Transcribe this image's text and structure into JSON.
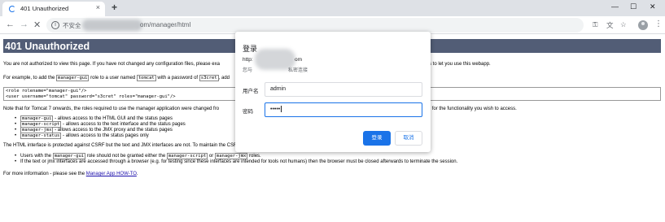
{
  "browser": {
    "tab": {
      "title": "401 Unauthorized",
      "close": "×"
    },
    "new_tab": "+",
    "window": {
      "minimize": "—",
      "maximize": "☐",
      "close": "✕"
    },
    "nav": {
      "back": "←",
      "forward": "→",
      "stop": "✕"
    },
    "address": {
      "security_label": "不安全",
      "path": "om/manager/html",
      "info": "i"
    },
    "toolbar_icons": {
      "key": "⚿",
      "translate": "文",
      "star": "☆",
      "menu": "⋮"
    }
  },
  "page": {
    "title": "401 Unauthorized",
    "intro_a": "You are not authorized to view this page. If you have not changed any configuration files, please exa",
    "intro_b": "e credentials to let you use this webapp.",
    "example_a": "For example, to add the",
    "example_role": "manager-gui",
    "example_b": "role to a user named",
    "example_user": "tomcat",
    "example_c": "with a password of",
    "example_pw": "s3cret",
    "example_d": ", add",
    "config_line1": "<role rolename=\"manager-gui\"/>",
    "config_line2": "<user username=\"tomcat\" password=\"s3cret\" roles=\"manager-gui\"/>",
    "tomcat7_a": "Note that for Tomcat 7 onwards, the roles required to use the manager application were changed fro",
    "tomcat7_b": "e(s) required for the functionality you wish to access.",
    "roles": [
      {
        "code": "manager-gui",
        "text": " - allows access to the HTML GUI and the status pages"
      },
      {
        "code": "manager-script",
        "text": " - allows access to the text interface and the status pages"
      },
      {
        "code": "manager-jmx",
        "text": " - allows access to the JMX proxy and the status pages"
      },
      {
        "code": "manager-status",
        "text": " - allows access to the status pages only"
      }
    ],
    "csrf_intro": "The HTML interface is protected against CSRF but the text and JMX interfaces are not. To maintain the CSRF protection:",
    "csrf_1a": "Users with the",
    "csrf_1_code1": "manager-gui",
    "csrf_1b": "role should not be granted either the",
    "csrf_1_code2": "manager-script",
    "csrf_1c": "or",
    "csrf_1_code3": "manager-jmx",
    "csrf_1d": "roles.",
    "csrf_2": "If the text or jmx interfaces are accessed through a browser (e.g. for testing since these interfaces are intended for tools not humans) then the browser must be closed afterwards to terminate the session.",
    "more_info_a": "For more information - please see the",
    "more_info_link": "Manager App HOW-TO",
    "more_info_b": "."
  },
  "dialog": {
    "title": "登录",
    "host_a": "http:",
    "host_b": "om",
    "note_a": "您与",
    "note_b": "私密连接",
    "username_label": "用户名",
    "username_value": "admin",
    "password_label": "密码",
    "password_value": "•••••",
    "ok_label": "登录",
    "cancel_label": "取消"
  },
  "colors": {
    "heading_bg": "#525d76",
    "accent": "#1a73e8",
    "link": "#1a0dab"
  }
}
